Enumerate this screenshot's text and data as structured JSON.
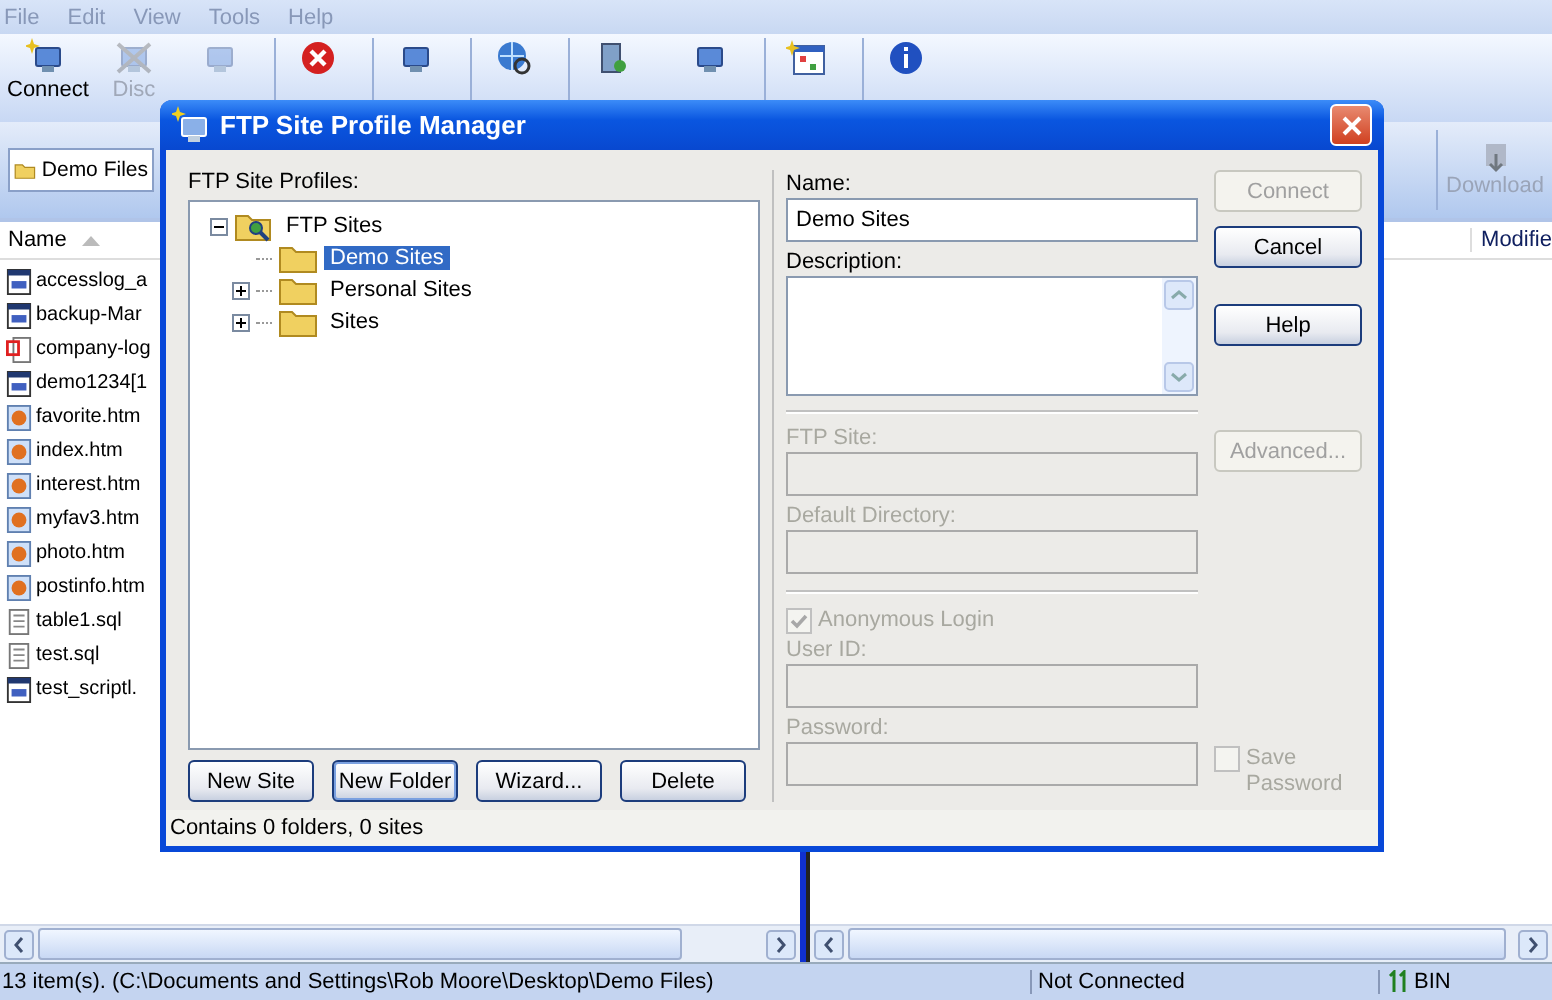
{
  "menu": [
    "File",
    "Edit",
    "View",
    "Tools",
    "Help"
  ],
  "toolbar": [
    {
      "kind": "connect",
      "label": "Connect",
      "disabled": false,
      "divider_before": false
    },
    {
      "kind": "disconnect",
      "label": "Disc",
      "disabled": true,
      "divider_before": false
    },
    {
      "kind": "reconnect",
      "disabled": true,
      "divider_before": false
    },
    {
      "kind": "stop",
      "disabled": false,
      "divider_before": true
    },
    {
      "kind": "options",
      "disabled": false,
      "divider_before": true
    },
    {
      "kind": "url",
      "disabled": false,
      "divider_before": true
    },
    {
      "kind": "kb",
      "disabled": false,
      "divider_before": true
    },
    {
      "kind": "support",
      "disabled": false,
      "divider_before": false
    },
    {
      "kind": "update",
      "disabled": false,
      "divider_before": true
    },
    {
      "kind": "about",
      "disabled": false,
      "divider_before": true
    }
  ],
  "left_pane": {
    "address": "Demo Files",
    "column": "Name",
    "files": [
      {
        "name": "accesslog_a",
        "kind": "window"
      },
      {
        "name": "backup-Mar",
        "kind": "window"
      },
      {
        "name": "company-log",
        "kind": "image"
      },
      {
        "name": "demo1234[1",
        "kind": "window"
      },
      {
        "name": "favorite.htm",
        "kind": "web"
      },
      {
        "name": "index.htm",
        "kind": "web"
      },
      {
        "name": "interest.htm",
        "kind": "web"
      },
      {
        "name": "myfav3.htm",
        "kind": "web"
      },
      {
        "name": "photo.htm",
        "kind": "web"
      },
      {
        "name": "postinfo.htm",
        "kind": "web"
      },
      {
        "name": "table1.sql",
        "kind": "text"
      },
      {
        "name": "test.sql",
        "kind": "text"
      },
      {
        "name": "test_scriptl.",
        "kind": "window"
      }
    ]
  },
  "right_pane": {
    "download": {
      "label": "Download",
      "disabled": true
    },
    "column": "Modifie"
  },
  "dialog": {
    "title": "FTP Site Profile Manager",
    "profiles_label": "FTP Site Profiles:",
    "tree": [
      {
        "label": "FTP Sites",
        "kind": "root",
        "expanded": true,
        "selected": false,
        "children": [
          {
            "label": "Demo Sites",
            "kind": "folder",
            "expandable": false,
            "selected": true
          },
          {
            "label": "Personal Sites",
            "kind": "folder",
            "expandable": true,
            "selected": false
          },
          {
            "label": "Sites",
            "kind": "folder",
            "expandable": true,
            "selected": false
          }
        ]
      }
    ],
    "tree_buttons": [
      {
        "label": "New Site",
        "focused": false
      },
      {
        "label": "New Folder",
        "focused": true
      },
      {
        "label": "Wizard...",
        "focused": false
      },
      {
        "label": "Delete",
        "focused": false
      }
    ],
    "fields": [
      {
        "kind": "input",
        "label": "Name:",
        "value": "Demo Sites",
        "disabled": false,
        "divider_before": false
      },
      {
        "kind": "textarea",
        "label": "Description:",
        "disabled": false,
        "divider_before": false
      },
      {
        "kind": "input",
        "label": "FTP Site:",
        "disabled": true,
        "divider_before": true
      },
      {
        "kind": "input",
        "label": "Default Directory:",
        "disabled": true,
        "divider_before": false
      },
      {
        "kind": "checkbox",
        "label": "Anonymous Login",
        "checked": true,
        "disabled": true,
        "divider_before": true
      },
      {
        "kind": "input",
        "label": "User ID:",
        "disabled": true,
        "divider_before": false
      },
      {
        "kind": "input",
        "label": "Password:",
        "disabled": true,
        "divider_before": false
      }
    ],
    "side_buttons": [
      {
        "label": "Connect",
        "disabled": true
      },
      {
        "label": "Cancel",
        "disabled": false
      },
      {
        "label": "Help",
        "disabled": false
      },
      {
        "label": "Advanced...",
        "disabled": true
      }
    ],
    "save_password": {
      "label": "Save Password",
      "checked": false,
      "disabled": true
    },
    "status": "Contains 0 folders, 0 sites"
  },
  "status_bar": {
    "path": "13 item(s).  (C:\\Documents and Settings\\Rob Moore\\Desktop\\Demo Files)",
    "connection": "Not Connected",
    "mode": "BIN"
  }
}
